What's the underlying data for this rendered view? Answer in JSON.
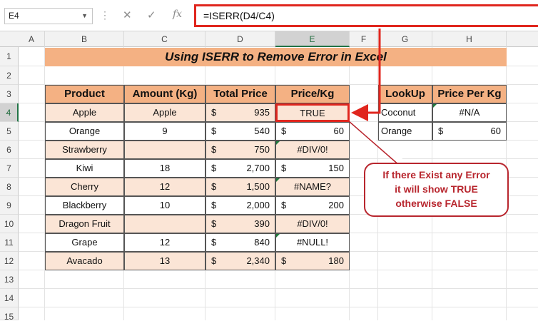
{
  "formula_bar": {
    "name_box": "E4",
    "formula": "=ISERR(D4/C4)",
    "cancel_glyph": "✕",
    "enter_glyph": "✓",
    "fx_glyph": "fx"
  },
  "columns": [
    "A",
    "B",
    "C",
    "D",
    "E",
    "F",
    "G",
    "H"
  ],
  "rows": [
    "1",
    "2",
    "3",
    "4",
    "5",
    "6",
    "7",
    "8",
    "9",
    "10",
    "11",
    "12",
    "13",
    "14",
    "15"
  ],
  "title": "Using ISERR to Remove Error in Excel",
  "table": {
    "headers": [
      "Product",
      "Amount (Kg)",
      "Total Price",
      "Price/Kg"
    ],
    "currency": "$",
    "rows": [
      {
        "product": "Apple",
        "amount": "Apple",
        "total": "935",
        "price": "TRUE",
        "price_is_money": false
      },
      {
        "product": "Orange",
        "amount": "9",
        "total": "540",
        "price": "60",
        "price_is_money": true
      },
      {
        "product": "Strawberry",
        "amount": "",
        "total": "750",
        "price": "#DIV/0!",
        "price_is_money": false
      },
      {
        "product": "Kiwi",
        "amount": "18",
        "total": "2,700",
        "price": "150",
        "price_is_money": true
      },
      {
        "product": "Cherry",
        "amount": "12",
        "total": "1,500",
        "price": "#NAME?",
        "price_is_money": false
      },
      {
        "product": "Blackberry",
        "amount": "10",
        "total": "2,000",
        "price": "200",
        "price_is_money": true
      },
      {
        "product": "Dragon Fruit",
        "amount": "",
        "total": "390",
        "price": "#DIV/0!",
        "price_is_money": false
      },
      {
        "product": "Grape",
        "amount": "12",
        "total": "840",
        "price": "#NULL!",
        "price_is_money": false
      },
      {
        "product": "Avacado",
        "amount": "13",
        "total": "2,340",
        "price": "180",
        "price_is_money": true
      }
    ]
  },
  "lookup": {
    "headers": [
      "LookUp",
      "Price Per Kg"
    ],
    "rows": [
      {
        "item": "Coconut",
        "value": "#N/A",
        "is_money": false
      },
      {
        "item": "Orange",
        "value": "60",
        "is_money": true
      }
    ]
  },
  "callout": {
    "line1": "If there Exist any Error",
    "line2": "it will show TRUE",
    "line3": "otherwise FALSE"
  },
  "colors": {
    "header_fill": "#f4b183",
    "band_fill": "#fbe5d6",
    "highlight_red": "#e0261e",
    "callout_red": "#b8262e"
  }
}
